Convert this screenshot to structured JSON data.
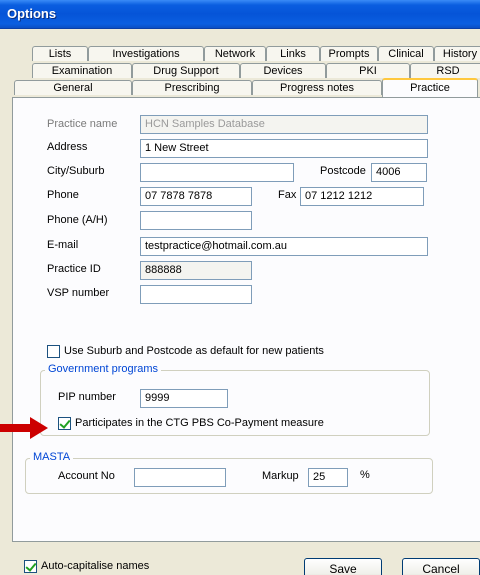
{
  "window": {
    "title": "Options"
  },
  "tabs": {
    "row1": [
      "Lists",
      "Investigations",
      "Network",
      "Links",
      "Prompts",
      "Clinical",
      "History"
    ],
    "row2": [
      "Examination",
      "Drug Support",
      "Devices",
      "PKI",
      "RSD"
    ],
    "row3": [
      "General",
      "Prescribing",
      "Progress notes",
      "Practice"
    ],
    "active": "Practice"
  },
  "practice": {
    "name": {
      "label": "Practice name",
      "value": "HCN Samples Database"
    },
    "address": {
      "label": "Address",
      "value": "1 New Street"
    },
    "city": {
      "label": "City/Suburb",
      "value": ""
    },
    "postcode": {
      "label": "Postcode",
      "value": "4006"
    },
    "phone": {
      "label": "Phone",
      "value": "07 7878 7878"
    },
    "fax": {
      "label": "Fax",
      "value": "07 1212 1212"
    },
    "phone_ah": {
      "label": "Phone (A/H)",
      "value": ""
    },
    "email": {
      "label": "E-mail",
      "value": "testpractice@hotmail.com.au"
    },
    "practice_id": {
      "label": "Practice ID",
      "value": "888888"
    },
    "vsp": {
      "label": "VSP number",
      "value": ""
    }
  },
  "suburb_default": {
    "label": "Use Suburb and Postcode as default for new patients",
    "checked": false
  },
  "government": {
    "title": "Government programs",
    "pip_label": "PIP number",
    "pip_value": "9999",
    "ctg_label": "Participates in the CTG PBS Co-Payment measure",
    "ctg_checked": true
  },
  "masta": {
    "title": "MASTA",
    "account_label": "Account No",
    "account_value": "",
    "markup_label": "Markup",
    "markup_value": "25",
    "percent": "%"
  },
  "footer": {
    "autocap_label": "Auto-capitalise names",
    "autocap_checked": true,
    "save": "Save",
    "cancel": "Cancel"
  },
  "colors": {
    "arrow": "#cc0000",
    "titlebar": "#0554d8",
    "group_title": "#0046d5",
    "check_tick": "#21a121"
  }
}
